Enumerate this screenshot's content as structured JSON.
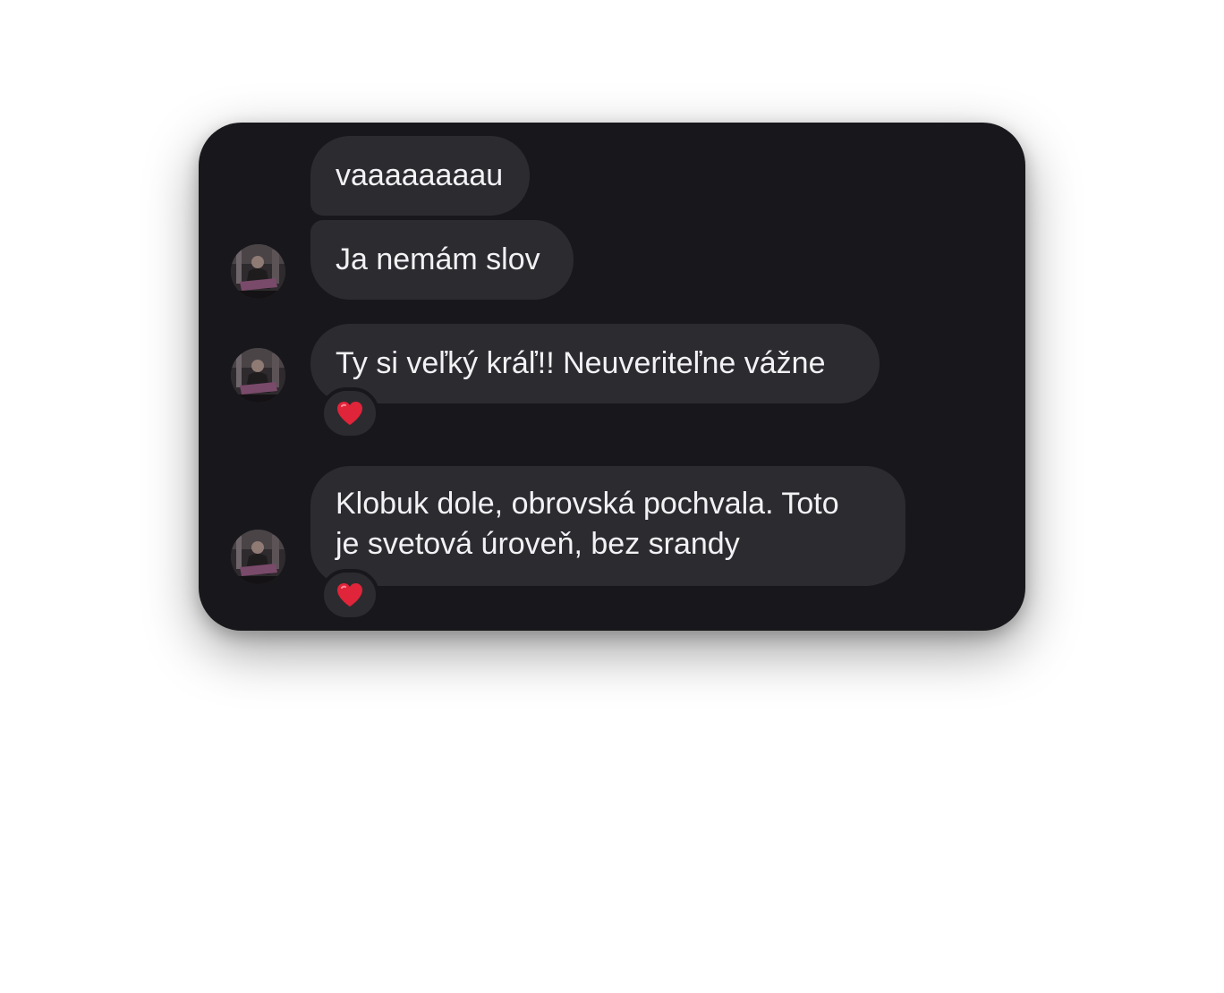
{
  "messages": [
    {
      "text": "vaaaaaaaau",
      "avatar": false,
      "reaction": null
    },
    {
      "text": "Ja nemám slov",
      "avatar": true,
      "reaction": null
    },
    {
      "text": "Ty si veľký kráľ!! Neuveriteľne vážne",
      "avatar": true,
      "reaction": "heart-icon"
    },
    {
      "text_lines": [
        "Klobuk dole, obrovská pochvala. Toto",
        "je svetová úroveň, bez srandy"
      ],
      "avatar": true,
      "reaction": "heart-icon"
    }
  ],
  "colors": {
    "card_background": "#18181c",
    "bubble_background": "#2c2c30",
    "text": "#f2f2f5",
    "reaction_heart": "#e0243a"
  }
}
